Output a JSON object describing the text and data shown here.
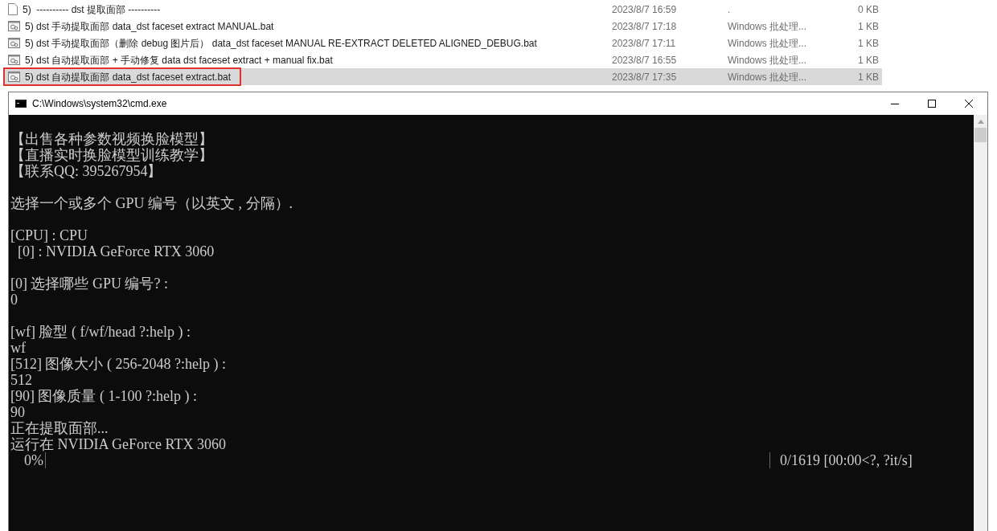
{
  "explorer": {
    "files": [
      {
        "kind": "blank",
        "name": "5)  ---------- dst 提取面部 ----------",
        "modified": "2023/8/7 16:59",
        "type": ".",
        "size": "0 KB",
        "selected": false
      },
      {
        "kind": "bat",
        "name": "5) dst 手动提取面部 data_dst faceset extract MANUAL.bat",
        "modified": "2023/8/7 17:18",
        "type": "Windows 批处理...",
        "size": "1 KB",
        "selected": false
      },
      {
        "kind": "bat",
        "name": "5) dst 手动提取面部（删除 debug 图片后） data_dst faceset MANUAL RE-EXTRACT DELETED ALIGNED_DEBUG.bat",
        "modified": "2023/8/7 17:11",
        "type": "Windows 批处理...",
        "size": "1 KB",
        "selected": false
      },
      {
        "kind": "bat",
        "name": "5) dst 自动提取面部 + 手动修复 data dst faceset extract + manual fix.bat",
        "modified": "2023/8/7 16:55",
        "type": "Windows 批处理...",
        "size": "1 KB",
        "selected": false
      },
      {
        "kind": "bat",
        "name": "5) dst 自动提取面部 data_dst faceset extract.bat",
        "modified": "2023/8/7 17:35",
        "type": "Windows 批处理...",
        "size": "1 KB",
        "selected": true
      }
    ]
  },
  "console_window": {
    "title": "C:\\Windows\\system32\\cmd.exe",
    "blocks": [
      {
        "lines": [
          "【出售各种参数视频换脸模型】",
          "【直播实时换脸模型训练教学】",
          "【联系QQ: 395267954】"
        ]
      },
      {
        "lines": [
          "选择一个或多个 GPU 编号（以英文 , 分隔）."
        ]
      },
      {
        "lines": [
          "[CPU] : CPU",
          "  [0] : NVIDIA GeForce RTX 3060"
        ]
      },
      {
        "lines": [
          "[0] 选择哪些 GPU 编号? :",
          "0"
        ]
      },
      {
        "lines": [
          "[wf] 脸型 ( f/wf/head ?:help ) :",
          "wf",
          "[512] 图像大小 ( 256-2048 ?:help ) :",
          "512",
          "[90] 图像质量 ( 1-100 ?:help ) :",
          "90",
          "正在提取面部...",
          "运行在 NVIDIA GeForce RTX 3060"
        ]
      }
    ],
    "progress": {
      "percent": "0%",
      "level": 0,
      "reading": "0/1619 [00:00<?, ?it/s]"
    }
  }
}
